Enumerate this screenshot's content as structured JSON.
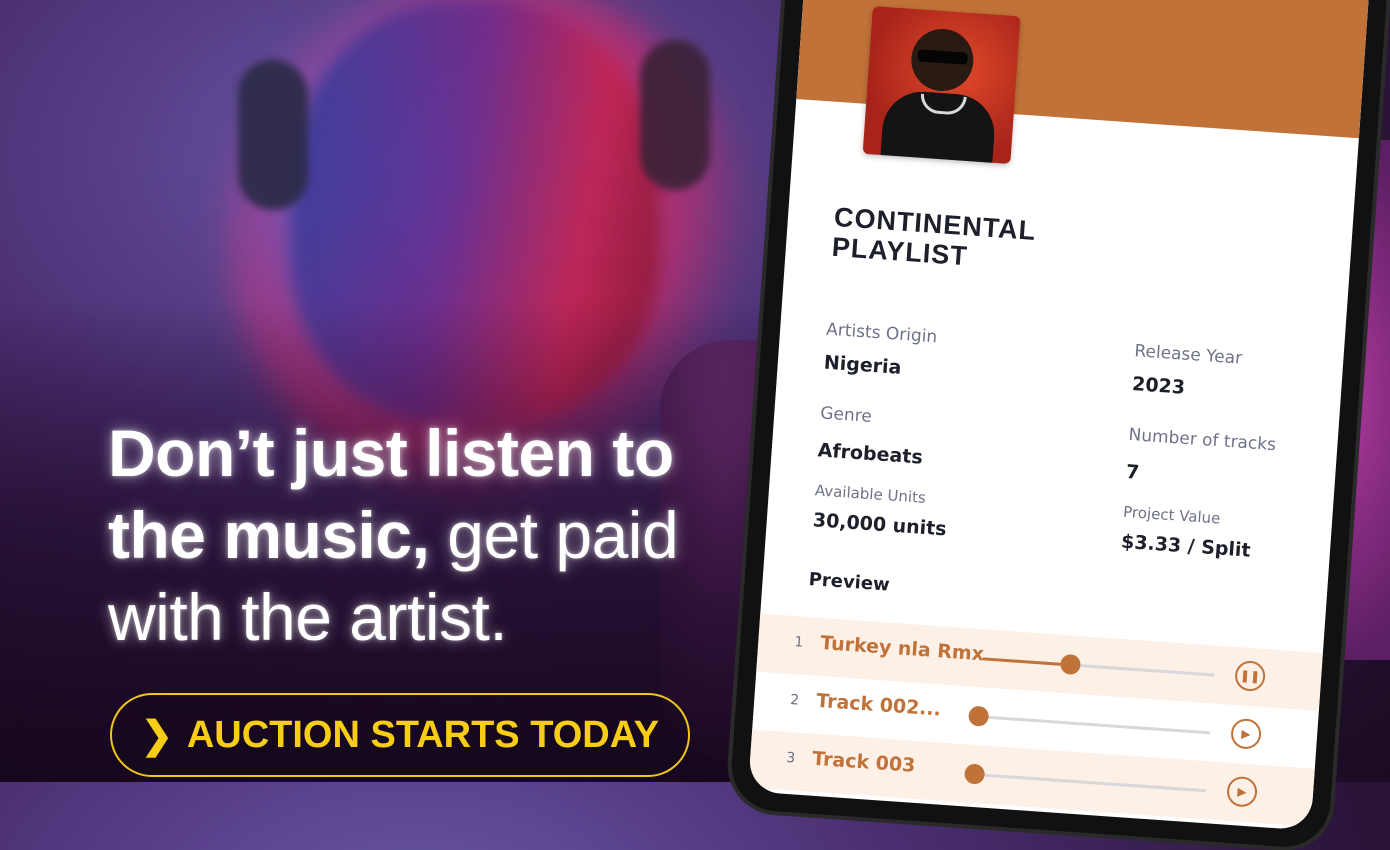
{
  "headline": {
    "bold": "Don’t just listen to the music,",
    "thin": "get paid with the artist."
  },
  "cta": {
    "icon": "chevron-right-icon",
    "label": "AUCTION STARTS TODAY",
    "color": "#f7cd16"
  },
  "playlist": {
    "title": "CONTINENTAL PLAYLIST",
    "accent_color": "#c17238",
    "details": [
      {
        "label": "Artists Origin",
        "value": "Nigeria"
      },
      {
        "label": "Release Year",
        "value": "2023"
      },
      {
        "label": "Genre",
        "value": "Afrobeats"
      },
      {
        "label": "Number of tracks",
        "value": "7"
      },
      {
        "label": "Available Units",
        "value": "30,000 units"
      },
      {
        "label": "Project Value",
        "value": "$3.33 / Split"
      }
    ],
    "preview_label": "Preview",
    "tracks": [
      {
        "number": "1",
        "name": "Turkey nla Rmx",
        "progress": 0.38,
        "control": "pause-icon",
        "control_glyph": "❚❚"
      },
      {
        "number": "2",
        "name": "Track 002...",
        "progress": 0.0,
        "control": "play-icon",
        "control_glyph": "▶"
      },
      {
        "number": "3",
        "name": "Track 003",
        "progress": 0.0,
        "control": "play-icon",
        "control_glyph": "▶"
      }
    ]
  }
}
